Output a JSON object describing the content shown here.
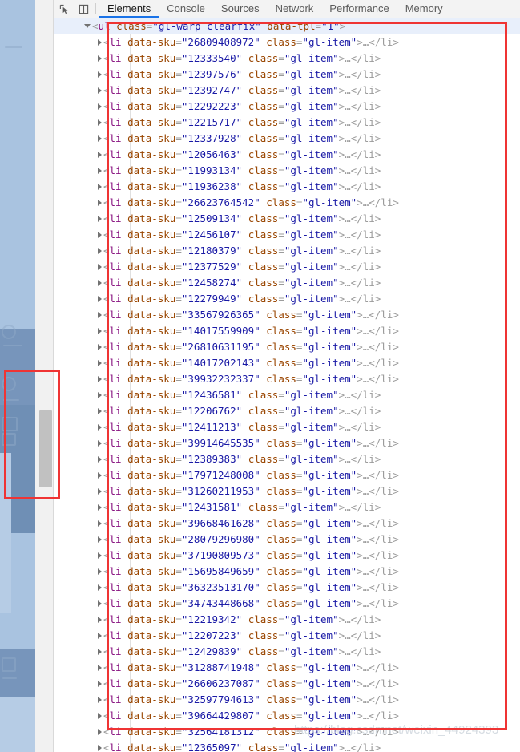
{
  "devtools": {
    "toolbar": {
      "inspect_icon": "inspect-element-icon",
      "device_icon": "device-toolbar-icon",
      "tabs": [
        {
          "label": "Elements",
          "active": true
        },
        {
          "label": "Console",
          "active": false
        },
        {
          "label": "Sources",
          "active": false
        },
        {
          "label": "Network",
          "active": false
        },
        {
          "label": "Performance",
          "active": false
        },
        {
          "label": "Memory",
          "active": false
        }
      ]
    },
    "dom_tree": {
      "root": {
        "expander": "triangle-down",
        "open_angle": "<",
        "tag": "ul",
        "space": " ",
        "attr_class_name": "class",
        "eq": "=",
        "quote": "\"",
        "attr_class_value": "gl-warp clearfix",
        "attr_tpl_name": "data-tpl",
        "attr_tpl_value": "1",
        "close_angle": ">",
        "highlighted": true
      },
      "child_template": {
        "expander": "triangle-right",
        "open_angle": "<",
        "tag": "li",
        "attr_sku_name": "data-sku",
        "attr_class_name": "class",
        "attr_class_value": "gl-item",
        "eq": "=",
        "quote": "\"",
        "close_angle": ">",
        "ellipsis": "…",
        "close_tag": "</li>"
      },
      "items": [
        {
          "sku": "26809408972"
        },
        {
          "sku": "12333540"
        },
        {
          "sku": "12397576"
        },
        {
          "sku": "12392747"
        },
        {
          "sku": "12292223"
        },
        {
          "sku": "12215717"
        },
        {
          "sku": "12337928"
        },
        {
          "sku": "12056463"
        },
        {
          "sku": "11993134"
        },
        {
          "sku": "11936238"
        },
        {
          "sku": "26623764542"
        },
        {
          "sku": "12509134"
        },
        {
          "sku": "12456107"
        },
        {
          "sku": "12180379"
        },
        {
          "sku": "12377529"
        },
        {
          "sku": "12458274"
        },
        {
          "sku": "12279949"
        },
        {
          "sku": "33567926365"
        },
        {
          "sku": "14017559909"
        },
        {
          "sku": "26810631195"
        },
        {
          "sku": "14017202143"
        },
        {
          "sku": "39932232337"
        },
        {
          "sku": "12436581"
        },
        {
          "sku": "12206762"
        },
        {
          "sku": "12411213"
        },
        {
          "sku": "39914645535"
        },
        {
          "sku": "12389383"
        },
        {
          "sku": "17971248008"
        },
        {
          "sku": "31260211953"
        },
        {
          "sku": "12431581"
        },
        {
          "sku": "39668461628"
        },
        {
          "sku": "28079296980"
        },
        {
          "sku": "37190809573"
        },
        {
          "sku": "15695849659"
        },
        {
          "sku": "36323513170"
        },
        {
          "sku": "34743448668"
        },
        {
          "sku": "12219342"
        },
        {
          "sku": "12207223"
        },
        {
          "sku": "12429839"
        },
        {
          "sku": "31288741948"
        },
        {
          "sku": "26606237087"
        },
        {
          "sku": "32597794613"
        },
        {
          "sku": "39664429807"
        },
        {
          "sku": "32564181312"
        },
        {
          "sku": "12365097"
        }
      ]
    }
  },
  "annotations": {
    "dom_rect_color": "#ef3434",
    "sidebar_rect_color": "#ef3434"
  },
  "watermark": {
    "text": "https://blog.csdn.net/weixin_44924393"
  },
  "scrollbar": {
    "thumb_label": "devtools-vertical-scroll-thumb"
  }
}
